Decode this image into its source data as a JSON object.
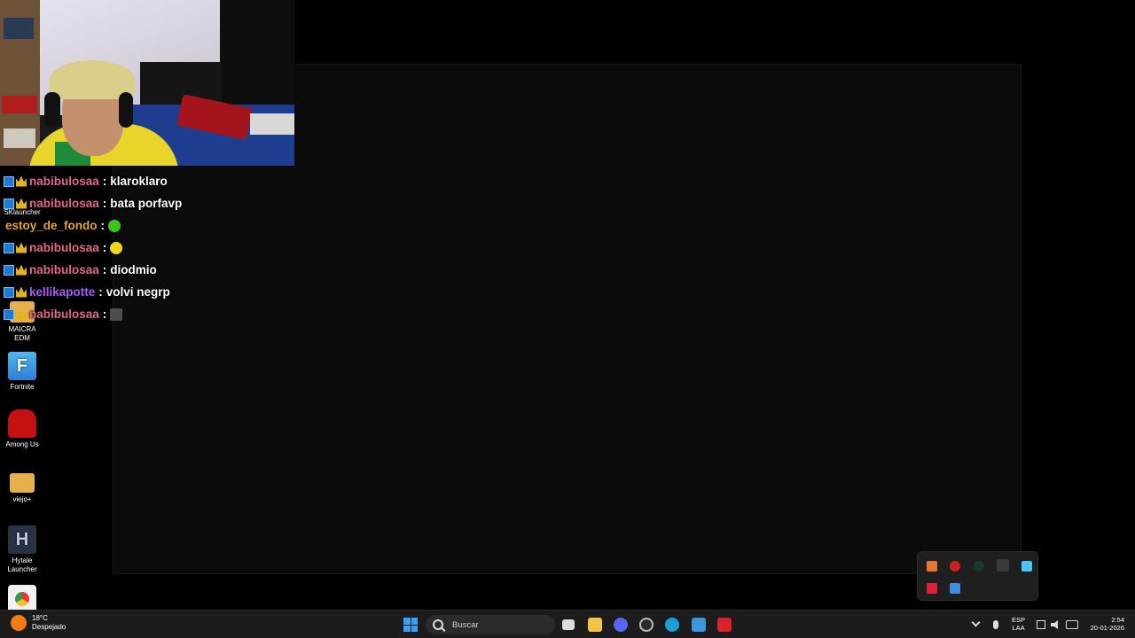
{
  "desktop": {
    "icons": [
      {
        "label": "SKlauncher"
      },
      {
        "label": "MAICRA EDM"
      },
      {
        "label": "Fortnite"
      },
      {
        "label": "Among Us"
      },
      {
        "label": "viejo+"
      },
      {
        "label": "Hytale Launcher"
      },
      {
        "label": ""
      }
    ]
  },
  "chat": {
    "messages": [
      {
        "user": "nabibulosaa",
        "separator": ":",
        "text": "klaroklaro",
        "user_color": "#e06a86",
        "badges": [
          "verified-icon",
          "crown-icon"
        ]
      },
      {
        "user": "nabibulosaa",
        "separator": ":",
        "text": "bata porfavp",
        "user_color": "#e06a86",
        "badges": [
          "verified-icon",
          "crown-icon"
        ]
      },
      {
        "user": "estoy_de_fondo",
        "separator": ":",
        "text": "",
        "emote": "green-emote",
        "user_color": "#e8a12a",
        "badges": []
      },
      {
        "user": "nabibulosaa",
        "separator": ":",
        "text": "",
        "emote": "yellow-emote",
        "user_color": "#e06a86",
        "badges": [
          "verified-icon",
          "crown-icon"
        ]
      },
      {
        "user": "nabibulosaa",
        "separator": ":",
        "text": "diodmio",
        "user_color": "#e06a86",
        "badges": [
          "verified-icon",
          "crown-icon"
        ]
      },
      {
        "user": "kellikapotte",
        "separator": ":",
        "text": "volvi negrp",
        "user_color": "#a45cf2",
        "badges": [
          "verified-icon",
          "crown-icon"
        ]
      },
      {
        "user": "nabibulosaa",
        "separator": ":",
        "text": "",
        "emote": "gray-emote",
        "user_color": "#e06a86",
        "badges": [
          "verified-icon",
          "crown-icon"
        ]
      }
    ]
  },
  "taskbar": {
    "weather_temp": "18°C",
    "weather_desc": "Despejado",
    "search_placeholder": "Buscar",
    "lang_line1": "ESP",
    "lang_line2": "LAA",
    "time": "2:54",
    "date": "20-01-2026",
    "colors": {
      "accent": "#3aa0f0",
      "background": "#1c1c1c"
    }
  }
}
